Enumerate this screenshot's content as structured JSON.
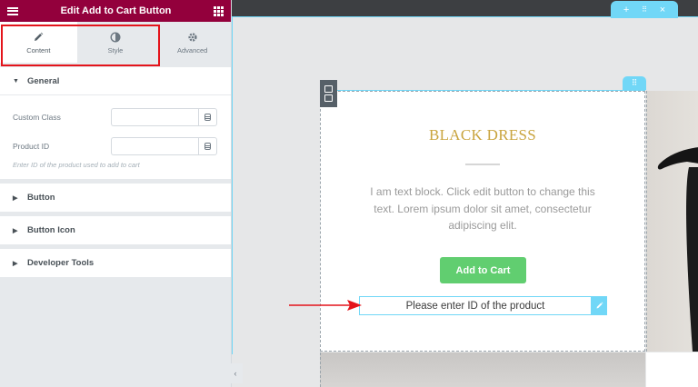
{
  "panel": {
    "title": "Edit Add to Cart Button",
    "tabs": [
      {
        "label": "Content",
        "icon": "pencil-icon"
      },
      {
        "label": "Style",
        "icon": "half-circle-icon"
      },
      {
        "label": "Advanced",
        "icon": "gear-icon"
      }
    ],
    "active_tab": "Content",
    "general": {
      "title": "General",
      "custom_class_label": "Custom Class",
      "product_id_label": "Product ID",
      "product_id_help": "Enter ID of the product used to add to cart"
    },
    "sections": [
      "Button",
      "Button Icon",
      "Developer Tools"
    ]
  },
  "preview": {
    "product_title": "BLACK DRESS",
    "text_block": "I am text block. Click edit button to change this text. Lorem ipsum dolor sit amet, consectetur adipiscing elit.",
    "add_to_cart_label": "Add to Cart",
    "notice": "Please enter ID of the product"
  },
  "colors": {
    "header": "#93003c",
    "highlight": "#e4141b",
    "accent": "#71d7f7",
    "button": "#61ce70",
    "title": "#c9a43e"
  }
}
